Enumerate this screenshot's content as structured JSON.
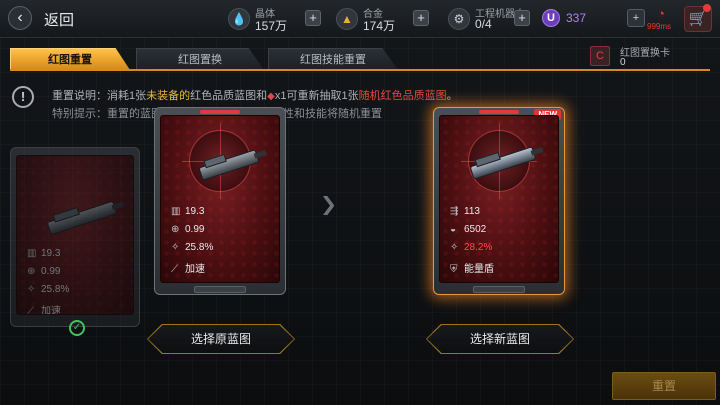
{
  "header": {
    "back_label": "返回",
    "resources": [
      {
        "label": "晶体",
        "value": "157万",
        "icon": "crystal-icon"
      },
      {
        "label": "合金",
        "value": "174万",
        "icon": "alloy-icon"
      },
      {
        "label": "工程机器人",
        "value": "0/4",
        "icon": "robot-icon"
      }
    ],
    "premium_value": "337",
    "premium_icon_glyph": "U",
    "ping": "999ms"
  },
  "tabs": [
    {
      "label": "红图重置",
      "active": true
    },
    {
      "label": "红图置换",
      "active": false
    },
    {
      "label": "红图技能重置",
      "active": false
    }
  ],
  "card_counter": {
    "label": "红图置换卡",
    "value": "0"
  },
  "info": {
    "line1_prefix": "重置说明：消耗1张",
    "line1_hl1": "未装备的",
    "line1_mid": "红色品质蓝图和",
    "line1_tag": "x1",
    "line1_mid2": "可重新抽取1张",
    "line1_red": "随机红色品质蓝图",
    "line1_suffix": "。",
    "line2": "特别提示：重置的蓝图除品质外，战舰种类、属性和技能将随机重置"
  },
  "cards": {
    "ghost": {
      "stats": [
        "19.3",
        "0.99",
        "25.8%",
        "加速"
      ]
    },
    "original": {
      "stats": [
        "19.3",
        "0.99",
        "25.8%",
        "加速"
      ]
    },
    "new": {
      "badge": "NEW",
      "stats": [
        "113",
        "6502",
        "28.2%",
        "能量盾"
      ],
      "highlight_color": "#ff4b4b"
    }
  },
  "buttons": {
    "pick_original": "选择原蓝图",
    "pick_new": "选择新蓝图",
    "reset": "重置"
  },
  "colors": {
    "accent": "#ffc24a",
    "card_red": "#7b1f22",
    "danger": "#e03c3c",
    "premium": "#a884f2"
  }
}
